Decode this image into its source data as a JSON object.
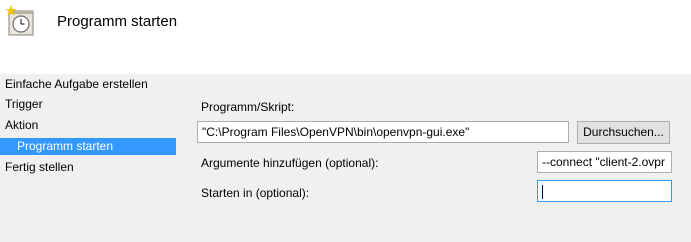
{
  "header": {
    "icon": "task-scheduler-clock-icon",
    "title": "Programm starten"
  },
  "steps": [
    {
      "label": "Einfache Aufgabe erstellen",
      "active": false
    },
    {
      "label": "Trigger",
      "active": false
    },
    {
      "label": "Aktion",
      "active": false
    },
    {
      "label": "Programm starten",
      "active": true
    },
    {
      "label": "Fertig stellen",
      "active": false
    }
  ],
  "form": {
    "program_label": "Programm/Skript:",
    "program_value": "\"C:\\Program Files\\OpenVPN\\bin\\openvpn-gui.exe\"",
    "browse_label": "Durchsuchen...",
    "arguments_label": "Argumente hinzufügen (optional):",
    "arguments_value": "--connect \"client-2.ovpr",
    "start_in_label": "Starten in (optional):",
    "start_in_value": ""
  },
  "colors": {
    "selection": "#3399ff",
    "header_bg": "#ffffff",
    "body_bg": "#f0f0f0"
  }
}
